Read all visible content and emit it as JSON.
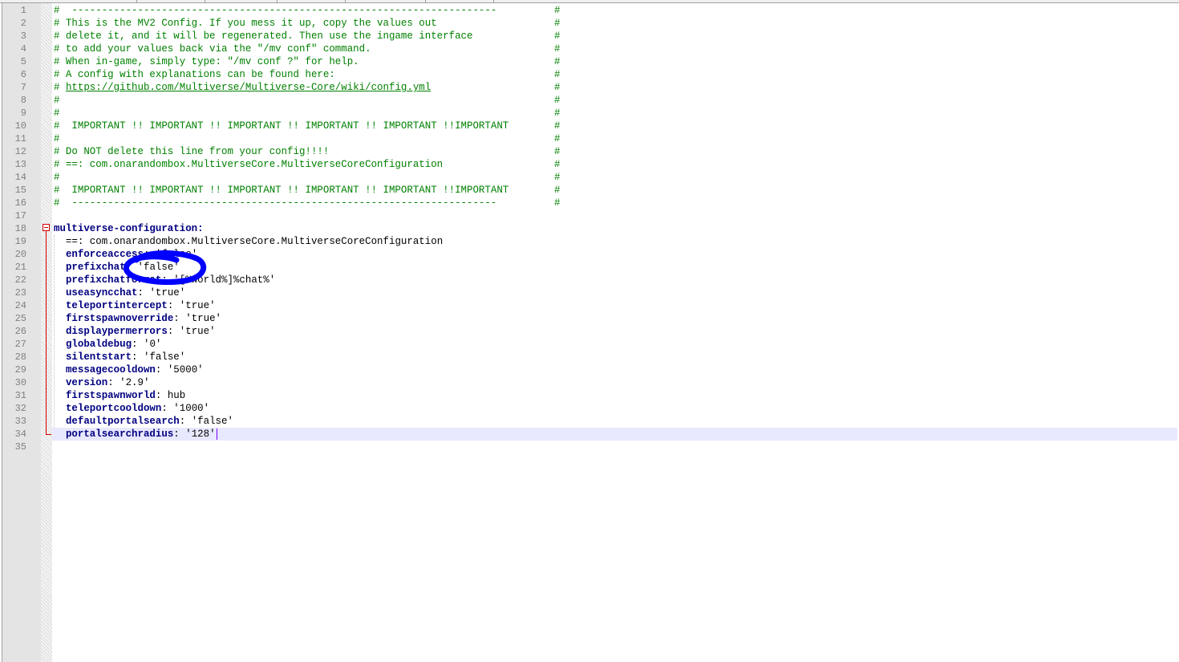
{
  "editor": {
    "accent_color": "#0000ff",
    "comment_color": "#008000",
    "key_color": "#000080",
    "current_line_color": "#e8e8ff",
    "caret_color": "#8000ff",
    "fold_marker_color": "#d00000"
  },
  "line_numbers": [
    "1",
    "2",
    "3",
    "4",
    "5",
    "6",
    "7",
    "8",
    "9",
    "10",
    "11",
    "12",
    "13",
    "14",
    "15",
    "16",
    "17",
    "18",
    "19",
    "20",
    "21",
    "22",
    "23",
    "24",
    "25",
    "26",
    "27",
    "28",
    "29",
    "30",
    "31",
    "32",
    "33",
    "34",
    "35"
  ],
  "comments": {
    "l1": "#  -----------------------------------------------------------------------",
    "l1_end": "#",
    "l2": "# This is the MV2 Config. If you mess it up, copy the values out",
    "l2_end": "#",
    "l3": "# delete it, and it will be regenerated. Then use the ingame interface",
    "l3_end": "#",
    "l4": "# to add your values back via the \"/mv conf\" command.",
    "l4_end": "#",
    "l5": "# When in-game, simply type: \"/mv conf ?\" for help.",
    "l5_end": "#",
    "l6": "# A config with explanations can be found here:",
    "l6_end": "#",
    "l7_prefix": "# ",
    "l7_link": "https://github.com/Multiverse/Multiverse-Core/wiki/config.yml",
    "l7_end": "#",
    "l8": "#",
    "l8_end": "#",
    "l9": "#",
    "l9_end": "#",
    "l10": "#  IMPORTANT !! IMPORTANT !! IMPORTANT !! IMPORTANT !! IMPORTANT !!IMPORTANT",
    "l10_end": "#",
    "l11": "#",
    "l11_end": "#",
    "l12": "# Do NOT delete this line from your config!!!!",
    "l12_end": "#",
    "l13": "# ==: com.onarandombox.MultiverseCore.MultiverseCoreConfiguration",
    "l13_end": "#",
    "l14": "#",
    "l14_end": "#",
    "l15": "#  IMPORTANT !! IMPORTANT !! IMPORTANT !! IMPORTANT !! IMPORTANT !!IMPORTANT",
    "l15_end": "#",
    "l16": "#  -----------------------------------------------------------------------",
    "l16_end": "#"
  },
  "config": {
    "root_key": "multiverse-configuration:",
    "class_line_indent": "  ==: ",
    "class_line_value": "com.onarandombox.MultiverseCore.MultiverseCoreConfiguration",
    "entries": [
      {
        "key": "enforceaccess",
        "sep": ": ",
        "value": "'false'"
      },
      {
        "key": "prefixchat",
        "sep": ": ",
        "value": "'false'"
      },
      {
        "key": "prefixchatformat",
        "sep": ": ",
        "value": "'[%world%]%chat%'"
      },
      {
        "key": "useasyncchat",
        "sep": ": ",
        "value": "'true'"
      },
      {
        "key": "teleportintercept",
        "sep": ": ",
        "value": "'true'"
      },
      {
        "key": "firstspawnoverride",
        "sep": ": ",
        "value": "'true'"
      },
      {
        "key": "displaypermerrors",
        "sep": ": ",
        "value": "'true'"
      },
      {
        "key": "globaldebug",
        "sep": ": ",
        "value": "'0'"
      },
      {
        "key": "silentstart",
        "sep": ": ",
        "value": "'false'"
      },
      {
        "key": "messagecooldown",
        "sep": ": ",
        "value": "'5000'"
      },
      {
        "key": "version",
        "sep": ": ",
        "value": "'2.9'"
      },
      {
        "key": "firstspawnworld",
        "sep": ": ",
        "value": "hub"
      },
      {
        "key": "teleportcooldown",
        "sep": ": ",
        "value": "'1000'"
      },
      {
        "key": "defaultportalsearch",
        "sep": ": ",
        "value": "'false'"
      },
      {
        "key": "portalsearchradius",
        "sep": ": ",
        "value": "'128'"
      }
    ]
  }
}
